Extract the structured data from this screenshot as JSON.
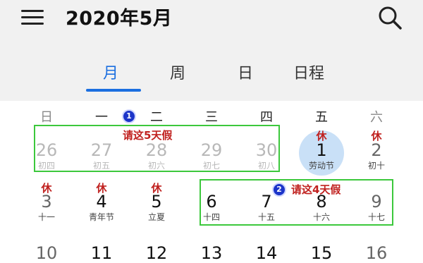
{
  "header": {
    "title": "2020年5月"
  },
  "tabs": [
    {
      "label": "月",
      "active": true
    },
    {
      "label": "周",
      "active": false
    },
    {
      "label": "日",
      "active": false
    },
    {
      "label": "日程",
      "active": false
    }
  ],
  "weekdays": [
    "日",
    "一",
    "二",
    "三",
    "四",
    "五",
    "六"
  ],
  "days": [
    {
      "num": "26",
      "lunar": "初四",
      "rest": "",
      "dim": true
    },
    {
      "num": "27",
      "lunar": "初五",
      "rest": "",
      "dim": true
    },
    {
      "num": "28",
      "lunar": "初六",
      "rest": "",
      "dim": true
    },
    {
      "num": "29",
      "lunar": "初七",
      "rest": "",
      "dim": true
    },
    {
      "num": "30",
      "lunar": "初八",
      "rest": "",
      "dim": true
    },
    {
      "num": "1",
      "lunar": "劳动节",
      "rest": "休",
      "today": true
    },
    {
      "num": "2",
      "lunar": "初十",
      "rest": "休"
    },
    {
      "num": "3",
      "lunar": "十一",
      "rest": "休"
    },
    {
      "num": "4",
      "lunar": "青年节",
      "rest": "休"
    },
    {
      "num": "5",
      "lunar": "立夏",
      "rest": "休"
    },
    {
      "num": "6",
      "lunar": "十四",
      "rest": ""
    },
    {
      "num": "7",
      "lunar": "十五",
      "rest": ""
    },
    {
      "num": "8",
      "lunar": "十六",
      "rest": ""
    },
    {
      "num": "9",
      "lunar": "十七",
      "rest": ""
    },
    {
      "num": "10",
      "lunar": "",
      "rest": ""
    },
    {
      "num": "11",
      "lunar": "",
      "rest": ""
    },
    {
      "num": "12",
      "lunar": "",
      "rest": ""
    },
    {
      "num": "13",
      "lunar": "",
      "rest": ""
    },
    {
      "num": "14",
      "lunar": "",
      "rest": ""
    },
    {
      "num": "15",
      "lunar": "",
      "rest": ""
    },
    {
      "num": "16",
      "lunar": "",
      "rest": ""
    }
  ],
  "annotations": {
    "box1": {
      "badge": "1",
      "text": "请这5天假"
    },
    "box2": {
      "badge": "2",
      "text": "请这4天假"
    }
  },
  "colors": {
    "accent": "#1b6fe0",
    "rest_red": "#c0211f",
    "highlight_green": "#3cc83c",
    "today_circle": "#c9e0f7",
    "badge_blue": "#1c35c9"
  },
  "icons": {
    "menu": "hamburger-menu-icon",
    "search": "search-icon"
  }
}
